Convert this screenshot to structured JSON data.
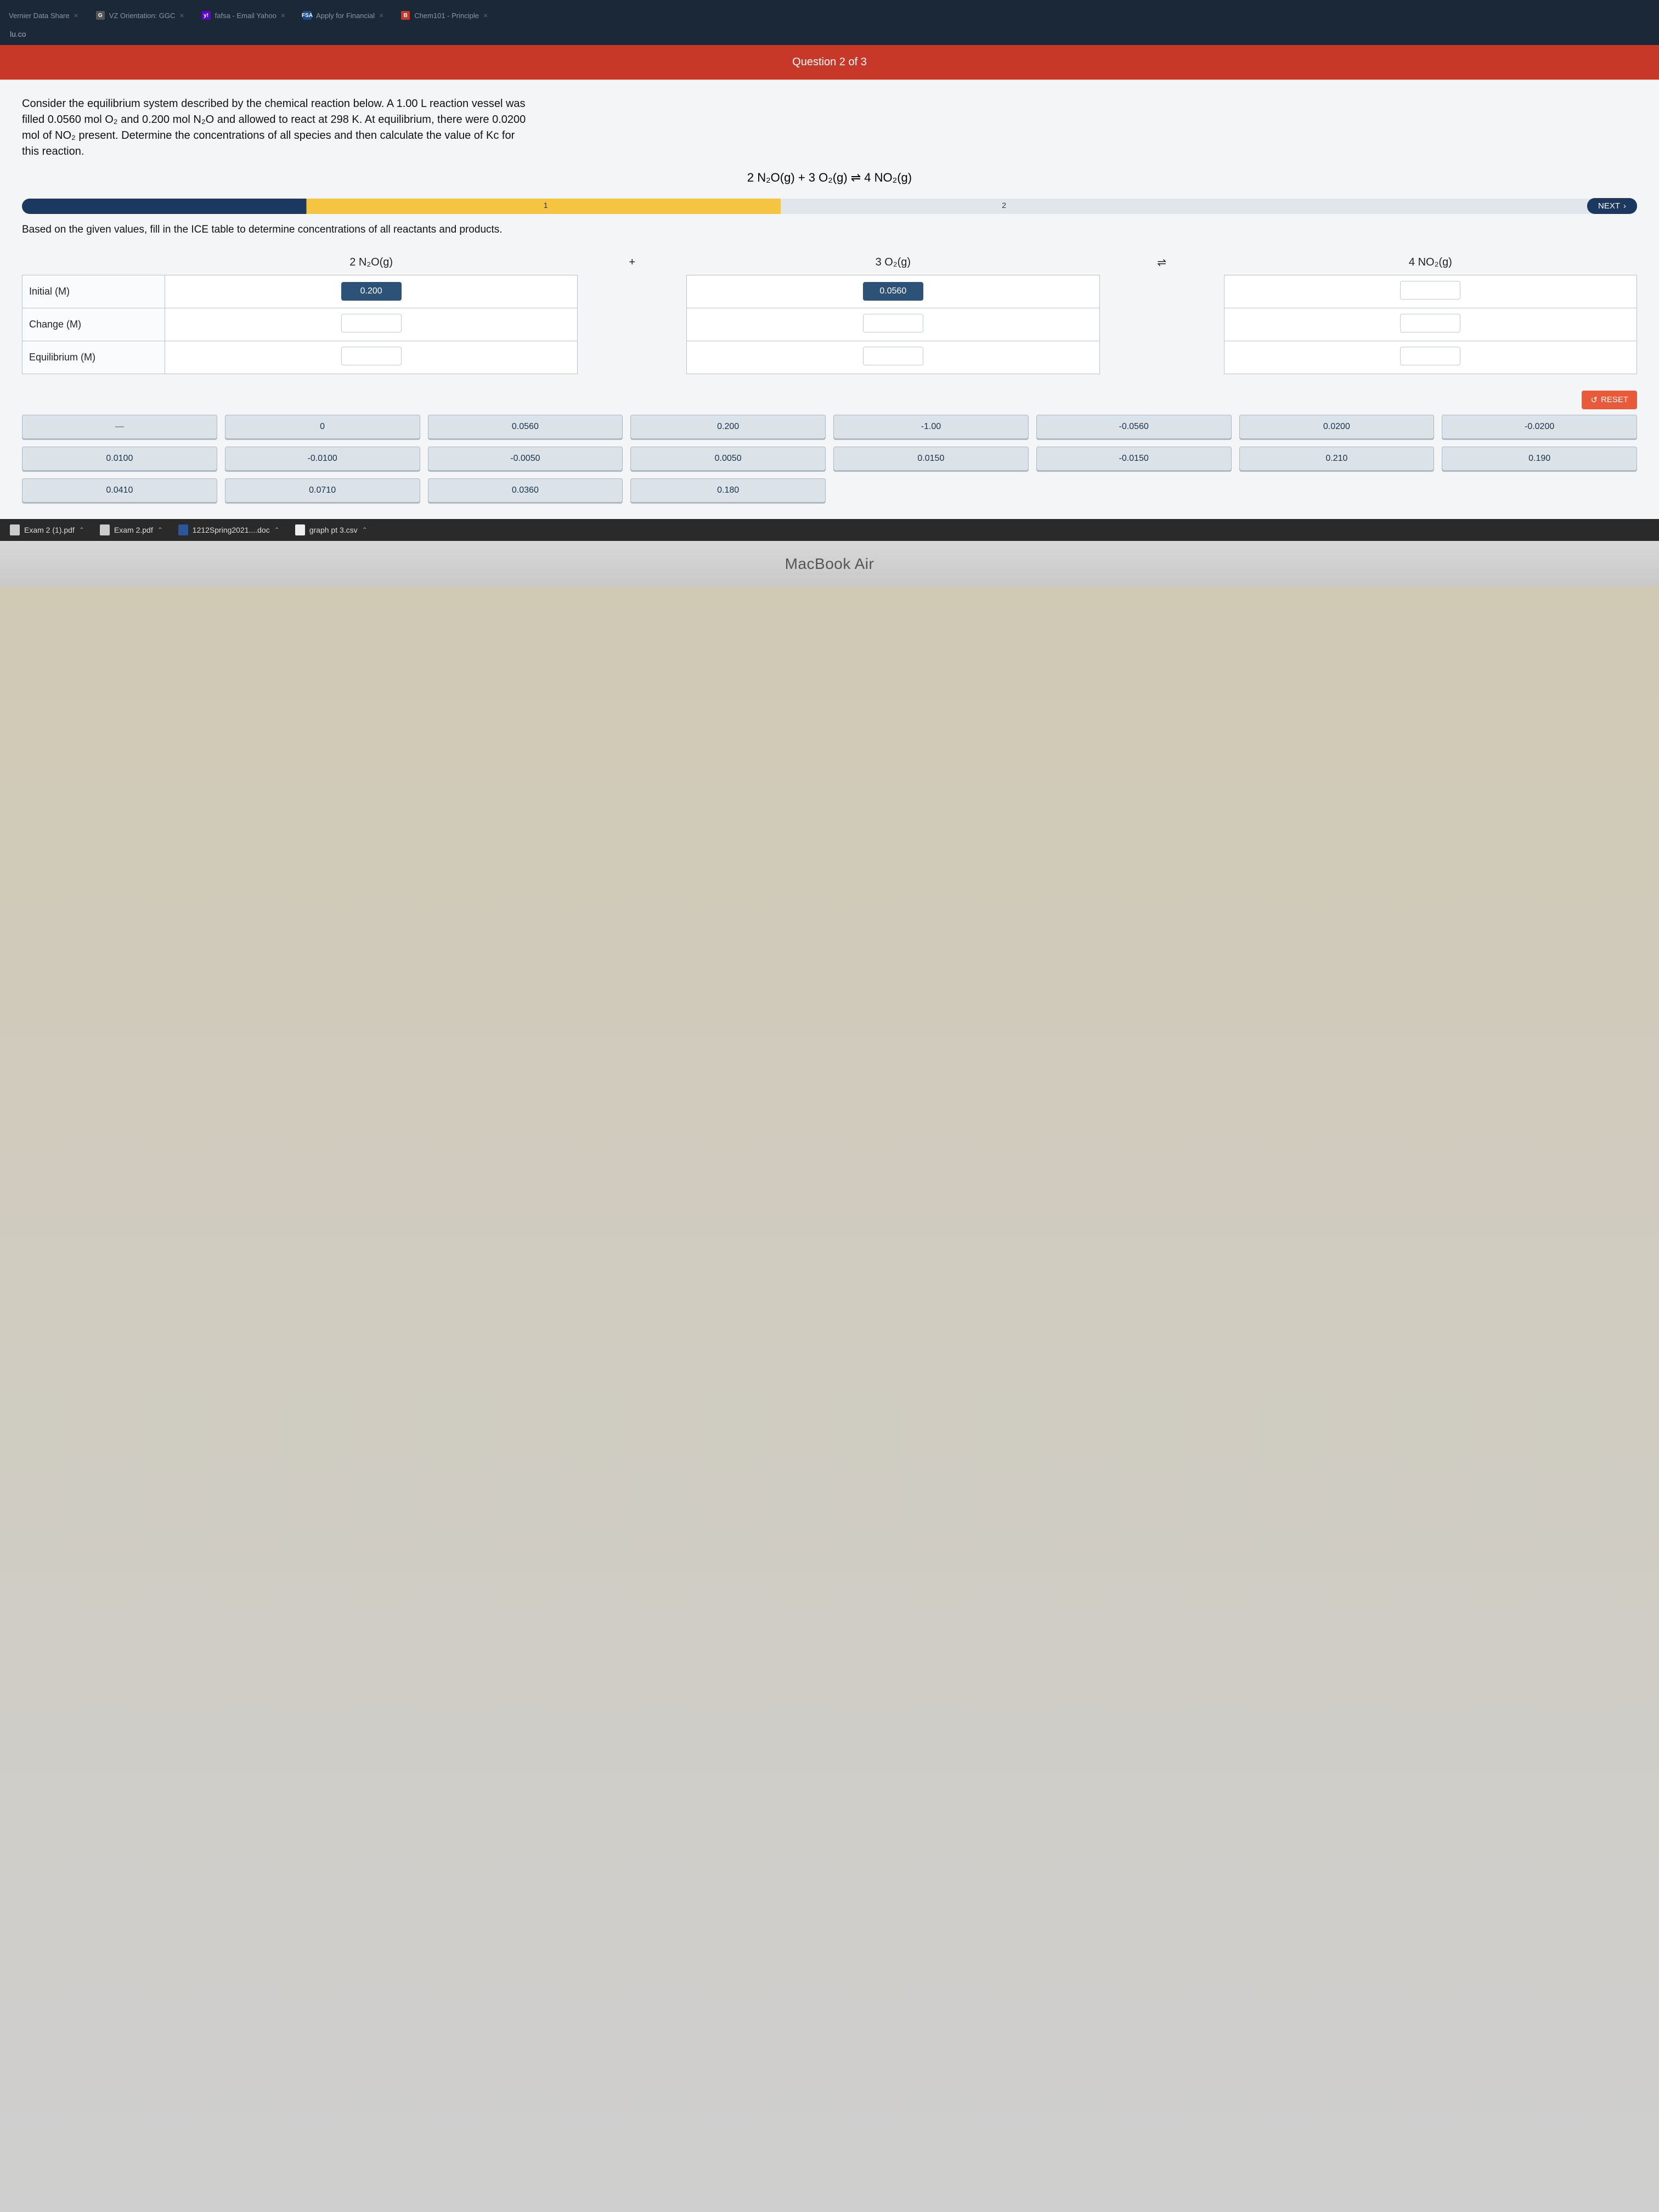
{
  "browser": {
    "tabs": [
      {
        "label": "Vernier Data Share",
        "favicon": ""
      },
      {
        "label": "VZ Orientation: GGC",
        "favicon": "G"
      },
      {
        "label": "fafsa - Email Yahoo",
        "favicon": "y!"
      },
      {
        "label": "Apply for Financial",
        "favicon": "FSA"
      },
      {
        "label": "Chem101 - Principle",
        "favicon": "B"
      }
    ],
    "address": "lu.co"
  },
  "banner": "Question 2 of 3",
  "prompt": "Consider the equilibrium system described by the chemical reaction below. A 1.00 L reaction vessel was filled 0.0560 mol O₂ and 0.200 mol N₂O and allowed to react at 298 K. At equilibrium, there were 0.0200 mol of NO₂ present. Determine the concentrations of all species and then calculate the value of Kc for this reaction.",
  "equation": "2 N₂O(g) + 3 O₂(g) ⇌ 4 NO₂(g)",
  "steps": {
    "s1": "1",
    "s2": "2",
    "next": "NEXT"
  },
  "subprompt": "Based on the given values, fill in the ICE table to determine concentrations of all reactants and products.",
  "table": {
    "cols": [
      "2 N₂O(g)",
      "+",
      "3 O₂(g)",
      "⇌",
      "4 NO₂(g)"
    ],
    "rows": [
      "Initial (M)",
      "Change (M)",
      "Equilibrium (M)"
    ],
    "filled": {
      "initial_n2o": "0.200",
      "initial_o2": "0.0560"
    }
  },
  "reset": "RESET",
  "tiles": [
    "—",
    "0",
    "0.0560",
    "0.200",
    "-1.00",
    "-0.0560",
    "0.0200",
    "-0.0200",
    "0.0100",
    "-0.0100",
    "-0.0050",
    "0.0050",
    "0.0150",
    "-0.0150",
    "0.210",
    "0.190",
    "0.0410",
    "0.0710",
    "0.0360",
    "0.180"
  ],
  "downloads": [
    {
      "name": "Exam 2 (1).pdf"
    },
    {
      "name": "Exam 2.pdf"
    },
    {
      "name": "1212Spring2021....doc"
    },
    {
      "name": "graph pt 3.csv"
    }
  ],
  "laptop": "MacBook Air"
}
